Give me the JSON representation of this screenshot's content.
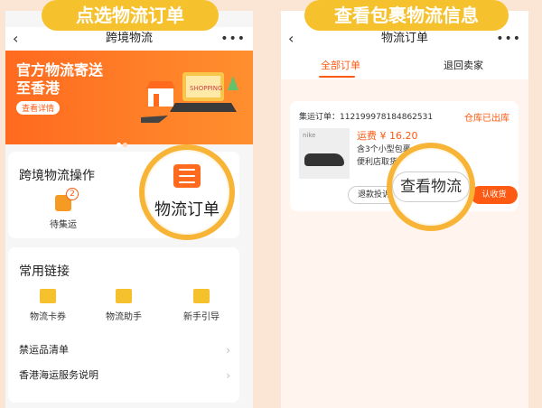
{
  "left": {
    "pill": "点选物流订单",
    "nav": {
      "title": "跨境物流",
      "back": "‹",
      "more": "•••"
    },
    "banner": {
      "title": "官方物流寄送至香港",
      "button": "查看详情",
      "illustration": "SHOPPING"
    },
    "ops": {
      "title": "跨境物流操作",
      "item": {
        "label": "待集运",
        "badge": "2"
      }
    },
    "magnifier": {
      "label": "物流订单"
    },
    "links": {
      "title": "常用链接",
      "items": [
        {
          "label": "物流卡券"
        },
        {
          "label": "物流助手"
        },
        {
          "label": "新手引导"
        }
      ],
      "rows": [
        {
          "label": "禁运品清单",
          "chevron": "›"
        },
        {
          "label": "香港海运服务说明",
          "chevron": "›"
        }
      ]
    }
  },
  "right": {
    "pill": "查看包裹物流信息",
    "nav": {
      "title": "物流订单",
      "back": "‹",
      "more": "•••"
    },
    "tabs": [
      {
        "label": "全部订单",
        "active": true
      },
      {
        "label": "退回卖家",
        "active": false
      }
    ],
    "order": {
      "number_label": "集运订单：112199978184862531",
      "status": "仓库已出库",
      "product_brand": "nike",
      "fee": "运费 ¥ 16.20",
      "packages": "含3个小型包裹",
      "pickup": "便利店取货",
      "btn_return": "退款投诉",
      "btn_confirm": "认收货"
    },
    "magnifier": {
      "label": "查看物流"
    }
  },
  "colors": {
    "accent": "#ff5a13",
    "pill": "#f5c12d",
    "ring": "#f8b436"
  }
}
